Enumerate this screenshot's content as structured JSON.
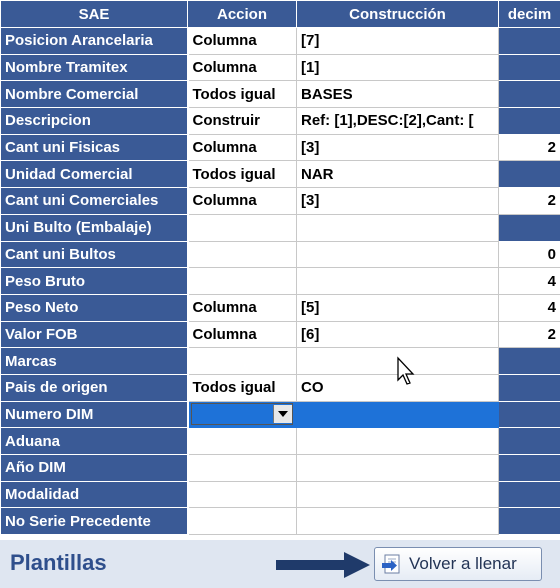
{
  "headers": {
    "sae": "SAE",
    "accion": "Accion",
    "construccion": "Construcción",
    "decim": "decim"
  },
  "rows": [
    {
      "sae": "Posicion Arancelaria",
      "accion": "Columna",
      "construccion": "[7]",
      "decim": ""
    },
    {
      "sae": "Nombre Tramitex",
      "accion": "Columna",
      "construccion": "[1]",
      "decim": ""
    },
    {
      "sae": "Nombre Comercial",
      "accion": "Todos igual",
      "construccion": "BASES",
      "decim": ""
    },
    {
      "sae": "Descripcion",
      "accion": "Construir",
      "construccion": "Ref: [1],DESC:[2],Cant: [",
      "decim": ""
    },
    {
      "sae": "Cant uni Fisicas",
      "accion": "Columna",
      "construccion": "[3]",
      "decim": "2"
    },
    {
      "sae": "Unidad Comercial",
      "accion": "Todos igual",
      "construccion": "NAR",
      "decim": ""
    },
    {
      "sae": "Cant uni Comerciales",
      "accion": "Columna",
      "construccion": "[3]",
      "decim": "2"
    },
    {
      "sae": "Uni Bulto (Embalaje)",
      "accion": "",
      "construccion": "",
      "decim": ""
    },
    {
      "sae": "Cant uni Bultos",
      "accion": "",
      "construccion": "",
      "decim": "0"
    },
    {
      "sae": "Peso Bruto",
      "accion": "",
      "construccion": "",
      "decim": "4"
    },
    {
      "sae": "Peso Neto",
      "accion": "Columna",
      "construccion": "[5]",
      "decim": "4"
    },
    {
      "sae": "Valor FOB",
      "accion": "Columna",
      "construccion": "[6]",
      "decim": "2"
    },
    {
      "sae": "Marcas",
      "accion": "",
      "construccion": "",
      "decim": ""
    },
    {
      "sae": "Pais de origen",
      "accion": "Todos igual",
      "construccion": "CO",
      "decim": ""
    },
    {
      "sae": "Numero DIM",
      "accion": "",
      "construccion": "",
      "decim": ""
    },
    {
      "sae": "Aduana",
      "accion": "",
      "construccion": "",
      "decim": ""
    },
    {
      "sae": "Año DIM",
      "accion": "",
      "construccion": "",
      "decim": ""
    },
    {
      "sae": "Modalidad",
      "accion": "",
      "construccion": "",
      "decim": ""
    },
    {
      "sae": "No Serie Precedente",
      "accion": "",
      "construccion": "",
      "decim": ""
    }
  ],
  "selected_row": 14,
  "footer": {
    "title": "Plantillas",
    "button_label": "Volver a llenar"
  },
  "colors": {
    "header_bg": "#3a5a96",
    "selection": "#1e72d8",
    "footer_bg": "#dfe6f1"
  }
}
